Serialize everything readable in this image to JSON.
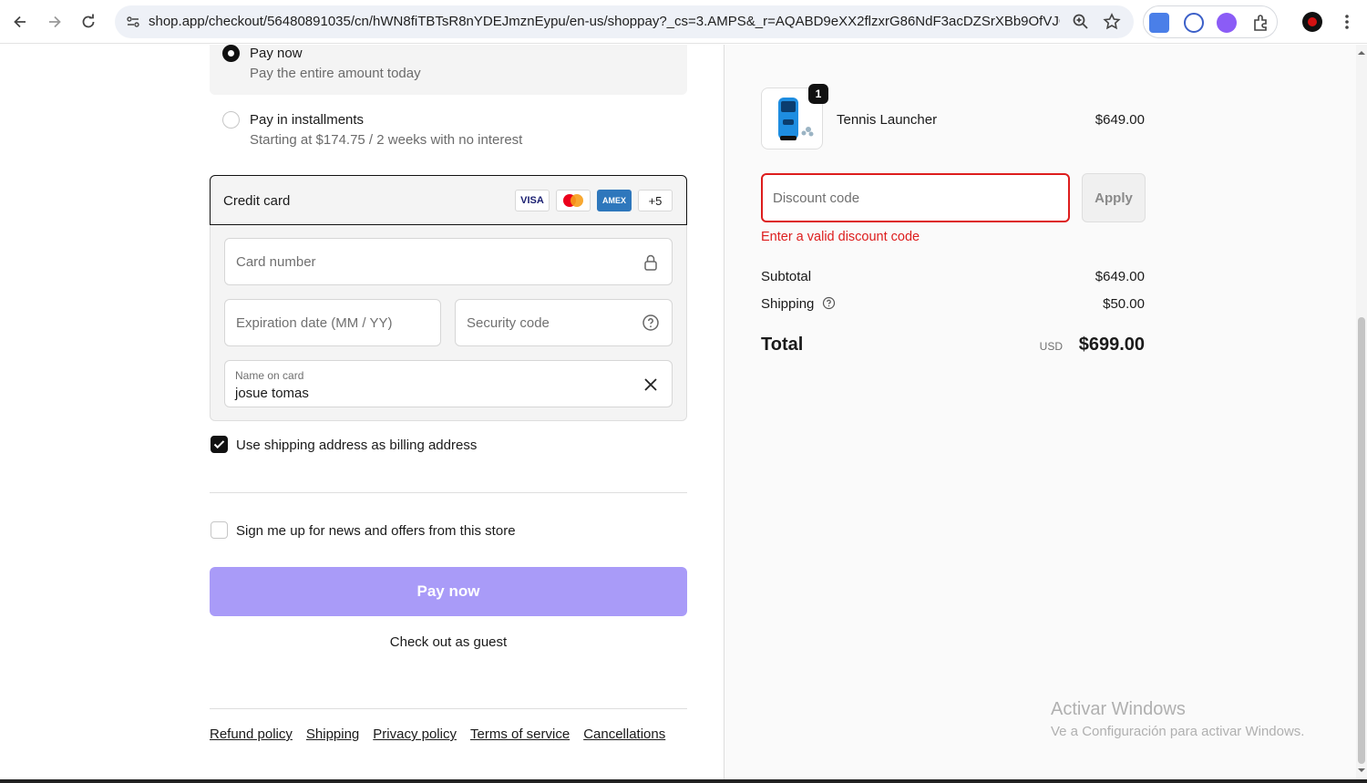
{
  "browser": {
    "url": "shop.app/checkout/56480891035/cn/hWN8fiTBTsR8nYDEJmznEypu/en-us/shoppay?_cs=3.AMPS&_r=AQABD9eXX2flzxrG86NdF3acDZSrXBb9OfVJG1y0ql..."
  },
  "payment": {
    "options": [
      {
        "title": "Pay now",
        "subtitle": "Pay the entire amount today",
        "selected": true
      },
      {
        "title": "Pay in installments",
        "subtitle": "Starting at $174.75 / 2 weeks with no interest",
        "selected": false
      }
    ],
    "credit_card": {
      "label": "Credit card",
      "brands": [
        "VISA",
        "Mastercard",
        "AMEX",
        "+5"
      ],
      "card_number_placeholder": "Card number",
      "expiration_placeholder": "Expiration date (MM / YY)",
      "security_placeholder": "Security code",
      "name_label": "Name on card",
      "name_value": "josue tomas"
    },
    "billing_checkbox_label": "Use shipping address as billing address",
    "billing_checked": true,
    "newsletter_label": "Sign me up for news and offers from this store",
    "newsletter_checked": false,
    "pay_button": "Pay now",
    "guest_link": "Check out as guest"
  },
  "footer": {
    "links": [
      "Refund policy",
      "Shipping",
      "Privacy policy",
      "Terms of service",
      "Cancellations"
    ]
  },
  "summary": {
    "product": {
      "name": "Tennis Launcher",
      "price": "$649.00",
      "quantity": "1"
    },
    "discount_placeholder": "Discount code",
    "apply_label": "Apply",
    "discount_error": "Enter a valid discount code",
    "subtotal_label": "Subtotal",
    "subtotal_value": "$649.00",
    "shipping_label": "Shipping",
    "shipping_value": "$50.00",
    "total_label": "Total",
    "currency": "USD",
    "total_value": "$699.00"
  },
  "watermark": {
    "line1": "Activar Windows",
    "line2": "Ve a Configuración para activar Windows."
  },
  "colors": {
    "accent": "#a99bf8",
    "error": "#dd1d1d"
  }
}
